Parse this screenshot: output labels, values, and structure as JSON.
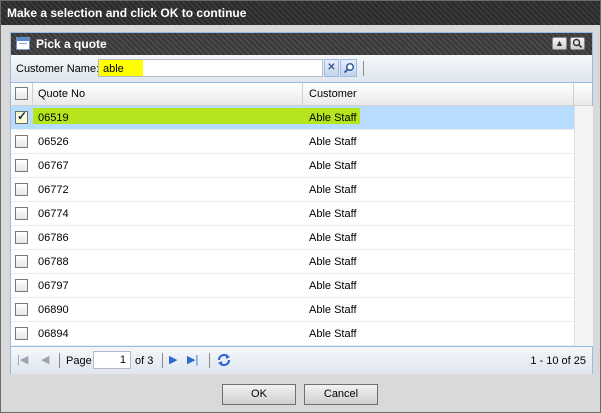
{
  "window": {
    "title": "Make a selection and click OK to continue"
  },
  "panel": {
    "title": "Pick a quote",
    "icon": "table-icon",
    "tools": [
      "collapse-icon",
      "search-icon"
    ]
  },
  "toolbar": {
    "customer_label": "Customer Name:",
    "search_value": "able",
    "clear_icon": "clear-icon",
    "search_icon": "search-icon"
  },
  "grid": {
    "columns": [
      "Quote No",
      "Customer"
    ],
    "rows": [
      {
        "quote": "06519",
        "customer": "Able Staff",
        "checked": true
      },
      {
        "quote": "06526",
        "customer": "Able Staff",
        "checked": false
      },
      {
        "quote": "06767",
        "customer": "Able Staff",
        "checked": false
      },
      {
        "quote": "06772",
        "customer": "Able Staff",
        "checked": false
      },
      {
        "quote": "06774",
        "customer": "Able Staff",
        "checked": false
      },
      {
        "quote": "06786",
        "customer": "Able Staff",
        "checked": false
      },
      {
        "quote": "06788",
        "customer": "Able Staff",
        "checked": false
      },
      {
        "quote": "06797",
        "customer": "Able Staff",
        "checked": false
      },
      {
        "quote": "06890",
        "customer": "Able Staff",
        "checked": false
      },
      {
        "quote": "06894",
        "customer": "Able Staff",
        "checked": false
      }
    ]
  },
  "paging": {
    "page_label": "Page",
    "page_value": "1",
    "of_label": "of 3",
    "summary": "1 - 10 of 25"
  },
  "buttons": {
    "ok": "OK",
    "cancel": "Cancel"
  },
  "colors": {
    "selected_row": "#b8dcff",
    "highlight_green": "#b5e61d",
    "search_highlight": "#ffff00"
  }
}
